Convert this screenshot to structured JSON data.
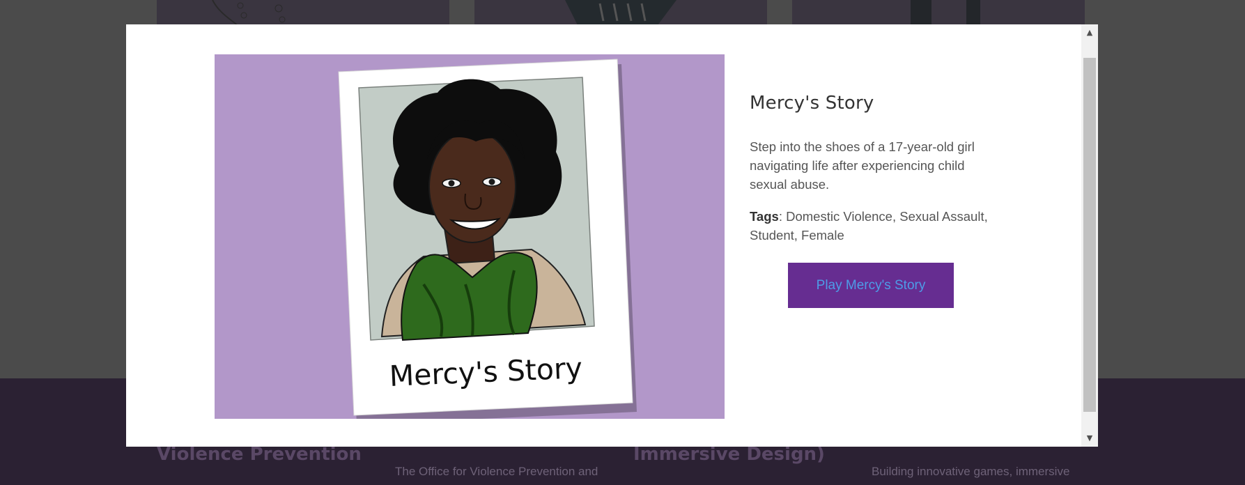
{
  "background": {
    "footer_columns": [
      {
        "heading": "(The Office for Violence Prevention",
        "text": ""
      },
      {
        "heading": "",
        "text": "The Office for Violence Prevention and"
      },
      {
        "heading": "Research & Immersive Design)",
        "text": ""
      },
      {
        "heading": "",
        "text": "Building innovative games, immersive"
      }
    ]
  },
  "modal": {
    "image_caption": "Mercy's Story",
    "title": "Mercy's Story",
    "description": "Step into the shoes of a 17-year-old girl navigating life after experiencing child sexual abuse.",
    "tags_label": "Tags",
    "tags_value": ": Domestic Violence, Sexual Assault, Student, Female",
    "play_button": "Play Mercy's Story"
  },
  "colors": {
    "hero_background": "#b297c9",
    "button_background": "#662d91",
    "button_text": "#4d9ce8",
    "footer_background": "#2b2133"
  },
  "icons": {
    "scroll_up": "triangle-up-icon",
    "scroll_down": "triangle-down-icon"
  }
}
